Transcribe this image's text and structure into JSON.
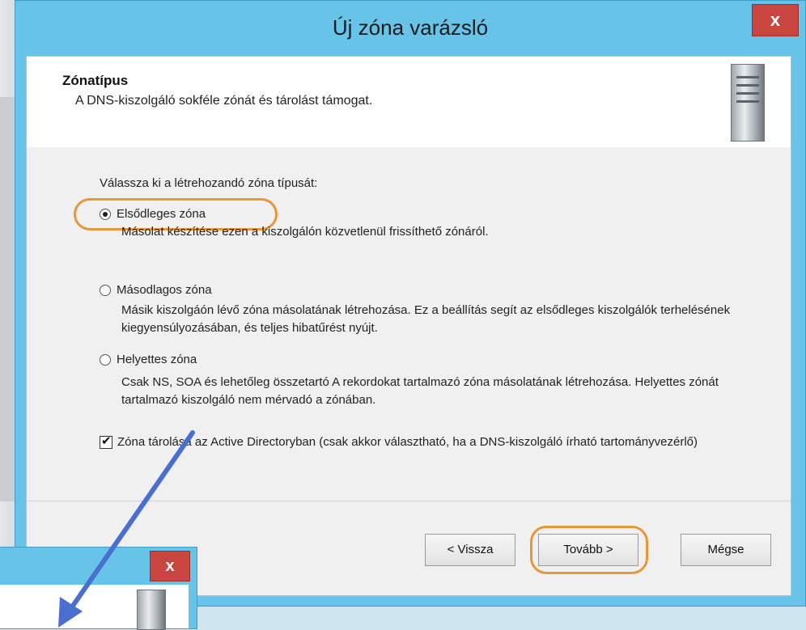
{
  "dialog": {
    "title": "Új zóna varázsló",
    "close_label": "x",
    "header": {
      "title": "Zónatípus",
      "subtitle": "A DNS-kiszolgáló sokféle zónát és tárolást támogat."
    },
    "prompt": "Válassza ki a létrehozandó zóna típusát:",
    "options": [
      {
        "label": "Elsődleges zóna",
        "checked": true,
        "description": "Másolat készítése ezen a kiszolgálón közvetlenül frissíthető zónáról."
      },
      {
        "label": "Másodlagos zóna",
        "checked": false,
        "description": "Másik kiszolgáón lévő zóna másolatának létrehozása. Ez a beállítás segít az elsődleges kiszolgálók terhelésének kiegyensúlyozásában, és teljes hibatűrést nyújt."
      },
      {
        "label": "Helyettes zóna",
        "checked": false,
        "description": "Csak NS, SOA és lehetőleg összetartó A rekordokat tartalmazó zóna másolatának létrehozása. Helyettes zónát tartalmazó kiszolgáló nem mérvadó a zónában."
      }
    ],
    "ad_checkbox": {
      "checked": true,
      "label": "Zóna tárolása az Active Directoryban (csak akkor választható, ha a DNS-kiszolgáló írható tartományvezérlő)"
    },
    "buttons": {
      "back": "< Vissza",
      "next": "Tovább >",
      "cancel": "Mégse"
    }
  },
  "second_dialog": {
    "close_label": "x"
  },
  "colors": {
    "titlebar": "#67c3e8",
    "close": "#c8463f",
    "highlight": "#e9953a",
    "arrow": "#4a6fd0"
  }
}
